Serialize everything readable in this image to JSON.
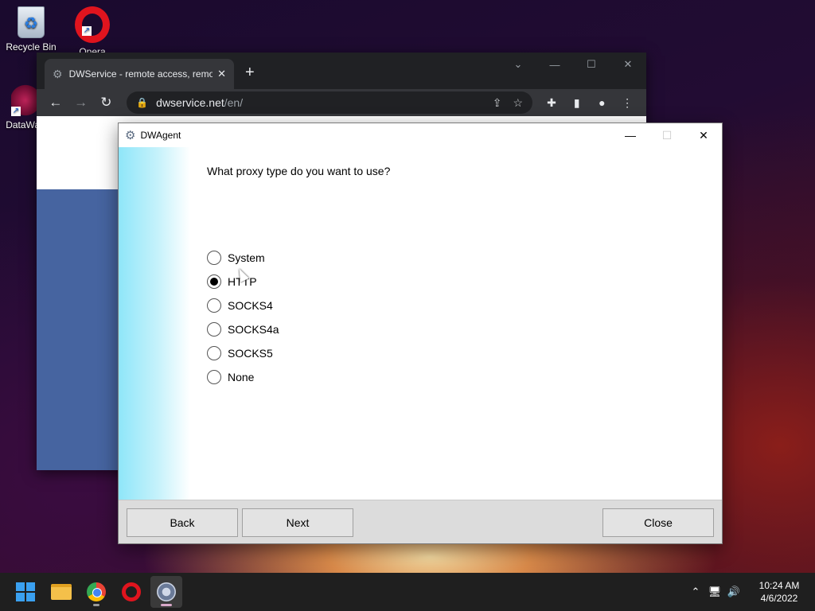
{
  "desktop": {
    "icons": [
      {
        "label": "Recycle Bin",
        "icon": "recycle-bin-icon"
      },
      {
        "label": "Opera",
        "icon": "opera-icon"
      },
      {
        "label": "DataWag",
        "icon": "datawag-icon"
      }
    ]
  },
  "browser": {
    "tab_title": "DWService - remote access, remo",
    "tab_close": "✕",
    "new_tab": "+",
    "url_host": "dwservice.net",
    "url_path": "/en/",
    "window_controls": {
      "chevron": "⌄",
      "minimize": "—",
      "maximize": "☐",
      "close": "✕"
    },
    "nav": {
      "back": "←",
      "forward": "→",
      "reload": "↻"
    }
  },
  "dialog": {
    "title": "DWAgent",
    "question": "What proxy type do you want to use?",
    "options": [
      {
        "label": "System",
        "checked": false
      },
      {
        "label": "HTTP",
        "checked": true
      },
      {
        "label": "SOCKS4",
        "checked": false
      },
      {
        "label": "SOCKS4a",
        "checked": false
      },
      {
        "label": "SOCKS5",
        "checked": false
      },
      {
        "label": "None",
        "checked": false
      }
    ],
    "buttons": {
      "back": "Back",
      "next": "Next",
      "close": "Close"
    },
    "controls": {
      "minimize": "—",
      "maximize": "☐",
      "close": "✕"
    }
  },
  "taskbar": {
    "apps": [
      "start-icon",
      "file-explorer-icon",
      "chrome-icon",
      "opera-icon",
      "dwagent-icon"
    ],
    "tray": {
      "chevron": "⌃",
      "network": "🖥",
      "volume": "🔊"
    },
    "time": "10:24 AM",
    "date": "4/6/2022"
  },
  "colors": {
    "accent_sidebar": "#8fe6f9",
    "windows_blue": "#3aa0f0",
    "browser_dark": "#35363a"
  }
}
